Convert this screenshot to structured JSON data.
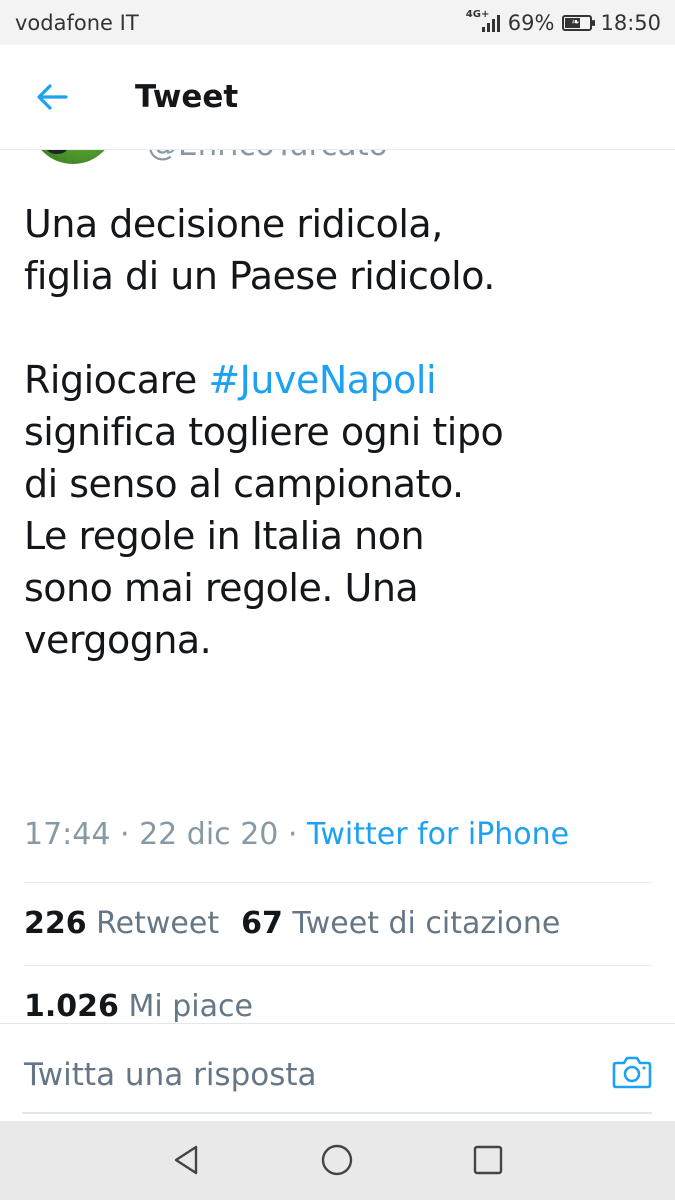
{
  "status_bar": {
    "carrier": "vodafone IT",
    "network": "4G+",
    "battery": "69%",
    "battery_level": 0.69,
    "time": "18:50"
  },
  "header": {
    "title": "Tweet",
    "back_icon": "arrow-left-icon"
  },
  "author": {
    "handle": "@EnricoTurcato"
  },
  "tweet": {
    "line1": "Una decisione ridicola,",
    "line2": "figlia di un Paese ridicolo.",
    "line3_prefix": "Rigiocare ",
    "hashtag": "#JuveNapoli",
    "line4": "significa togliere ogni tipo",
    "line5": "di senso al campionato.",
    "line6": "Le regole in Italia non",
    "line7": "sono mai regole. Una",
    "line8": "vergogna."
  },
  "meta": {
    "time": "17:44",
    "date": "22 dic 20",
    "separator": " · ",
    "source": "Twitter for iPhone"
  },
  "stats": {
    "retweets_count": "226",
    "retweets_label": "Retweet",
    "quotes_count": "67",
    "quotes_label": "Tweet di citazione",
    "likes_count": "1.026",
    "likes_label": "Mi piace"
  },
  "reply": {
    "placeholder": "Twitta una risposta",
    "camera_icon": "camera-icon"
  },
  "nav": {
    "back": "nav-back-icon",
    "home": "nav-home-icon",
    "recents": "nav-recents-icon"
  },
  "colors": {
    "accent": "#1da1f2",
    "text": "#14171a",
    "secondary": "#657786"
  }
}
